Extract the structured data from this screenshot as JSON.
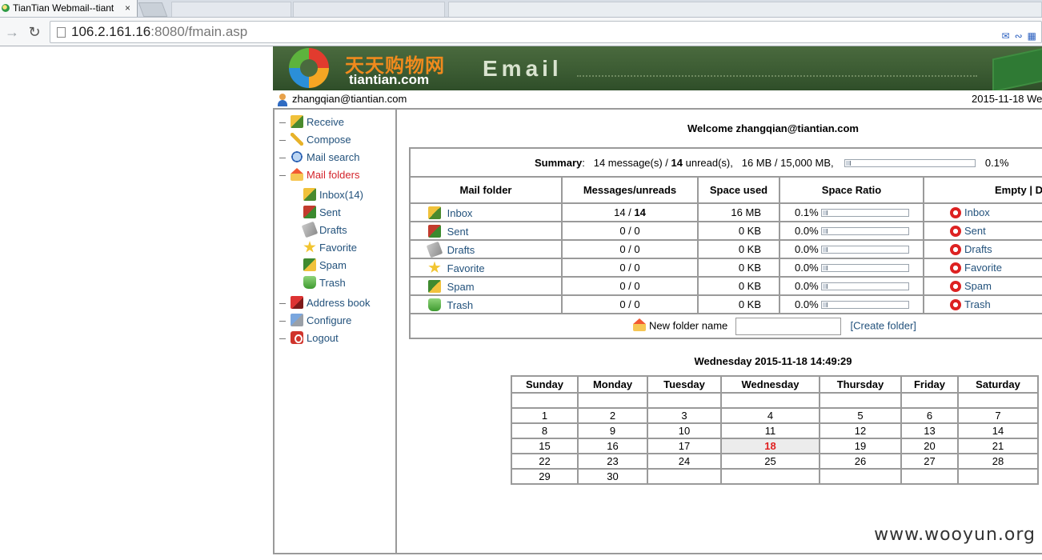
{
  "browser": {
    "active_tab_title": "TianTian Webmail--tiant",
    "tab_close": "×",
    "url_host": "106.2.161.16",
    "url_rest": ":8080/fmain.asp"
  },
  "header": {
    "brand_cn": "天天购物网",
    "brand_en": "tiantian.com",
    "title": "Email"
  },
  "user": {
    "email": "zhangqian@tiantian.com",
    "datetime": "2015-11-18 We"
  },
  "sidebar": {
    "items": [
      {
        "label": "Receive",
        "icon": "inbox-icon"
      },
      {
        "label": "Compose",
        "icon": "pencil-icon"
      },
      {
        "label": "Mail search",
        "icon": "search-icon"
      },
      {
        "label": "Mail folders",
        "icon": "folder-icon"
      },
      {
        "label": "Address book",
        "icon": "address-book-icon"
      },
      {
        "label": "Configure",
        "icon": "configure-icon"
      },
      {
        "label": "Logout",
        "icon": "logout-icon"
      }
    ],
    "folders": [
      {
        "label": "Inbox(14)"
      },
      {
        "label": "Sent"
      },
      {
        "label": "Drafts"
      },
      {
        "label": "Favorite"
      },
      {
        "label": "Spam"
      },
      {
        "label": "Trash"
      }
    ]
  },
  "main": {
    "welcome": "Welcome zhangqian@tiantian.com",
    "summary": {
      "label": "Summary",
      "colon": ":",
      "messages": "14 message(s) / ",
      "unread_count": "14",
      "unread_text": " unread(s),",
      "space": "16 MB / 15,000 MB,",
      "ratio": "0.1%",
      "ratio_value": 0.001
    },
    "columns": [
      "Mail folder",
      "Messages/unreads",
      "Space used",
      "Space Ratio",
      "Empty | D"
    ],
    "folders": [
      {
        "name": "Inbox",
        "messages": "14 / ",
        "unreads": "14",
        "space": "16 MB",
        "ratio": "0.1%",
        "ratio_value": 0.001,
        "empty": "Inbox"
      },
      {
        "name": "Sent",
        "messages": "0 / 0",
        "unreads": "",
        "space": "0 KB",
        "ratio": "0.0%",
        "ratio_value": 0,
        "empty": "Sent"
      },
      {
        "name": "Drafts",
        "messages": "0 / 0",
        "unreads": "",
        "space": "0 KB",
        "ratio": "0.0%",
        "ratio_value": 0,
        "empty": "Drafts"
      },
      {
        "name": "Favorite",
        "messages": "0 / 0",
        "unreads": "",
        "space": "0 KB",
        "ratio": "0.0%",
        "ratio_value": 0,
        "empty": "Favorite"
      },
      {
        "name": "Spam",
        "messages": "0 / 0",
        "unreads": "",
        "space": "0 KB",
        "ratio": "0.0%",
        "ratio_value": 0,
        "empty": "Spam"
      },
      {
        "name": "Trash",
        "messages": "0 / 0",
        "unreads": "",
        "space": "0 KB",
        "ratio": "0.0%",
        "ratio_value": 0,
        "empty": "Trash"
      }
    ],
    "new_folder_label": "New folder name",
    "new_folder_value": "",
    "create_folder": "[Create folder]"
  },
  "calendar": {
    "title": "Wednesday 2015-11-18 14:49:29",
    "days": [
      "Sunday",
      "Monday",
      "Tuesday",
      "Wednesday",
      "Thursday",
      "Friday",
      "Saturday"
    ],
    "weeks": [
      [
        "",
        "",
        "",
        "",
        "",
        "",
        ""
      ],
      [
        "1",
        "2",
        "3",
        "4",
        "5",
        "6",
        "7"
      ],
      [
        "8",
        "9",
        "10",
        "11",
        "12",
        "13",
        "14"
      ],
      [
        "15",
        "16",
        "17",
        "18",
        "19",
        "20",
        "21"
      ],
      [
        "22",
        "23",
        "24",
        "25",
        "26",
        "27",
        "28"
      ],
      [
        "29",
        "30",
        "",
        "",
        "",
        "",
        ""
      ]
    ],
    "today": "18"
  },
  "watermark": "www.wooyun.org"
}
